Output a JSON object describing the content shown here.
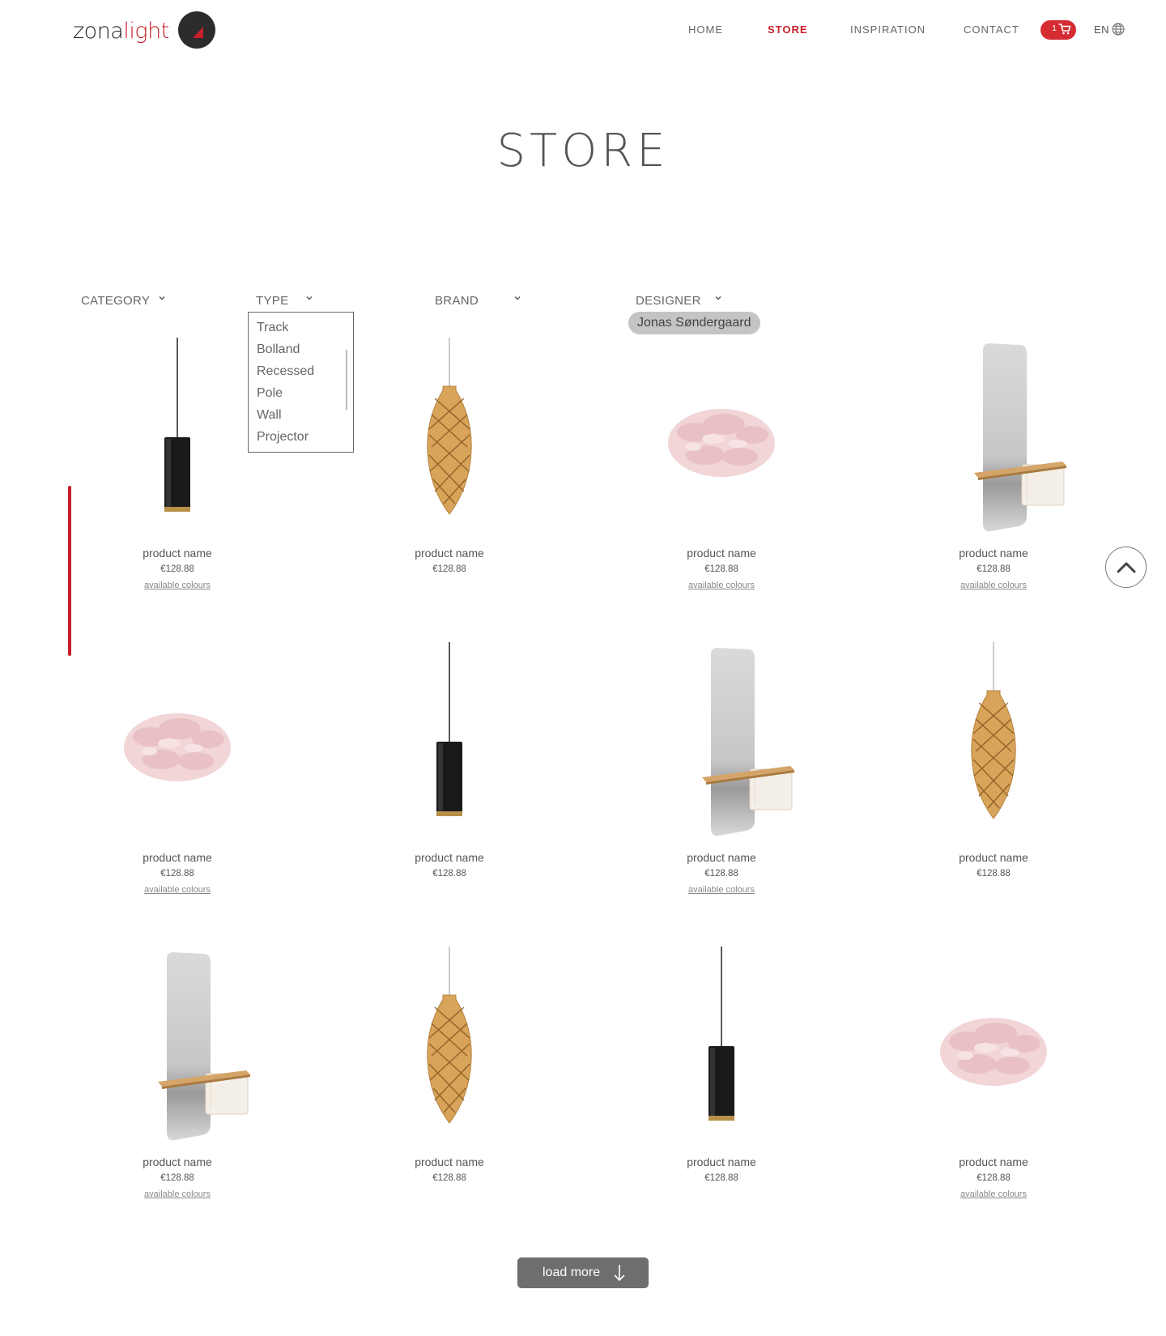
{
  "header": {
    "logo_text_dark": "zona",
    "logo_text_accent": "light",
    "nav": [
      "HOME",
      "STORE",
      "INSPIRATION",
      "CONTACT"
    ],
    "active_nav": "STORE",
    "cart_count": "1",
    "language": "EN",
    "icons": {
      "cart": "cart-icon",
      "globe": "globe-icon"
    }
  },
  "page_title": "STORE",
  "filters": {
    "category": "CATEGORY",
    "type": "TYPE",
    "brand": "BRAND",
    "designer": "DESIGNER",
    "type_options": [
      "Track",
      "Bolland",
      "Recessed",
      "Pole",
      "Wall",
      "Projector"
    ],
    "designer_selected": "Jonas Søndergaard"
  },
  "products": [
    {
      "image": "pendant-cylinder-black",
      "name": "product name",
      "price": "€128.88",
      "colours": "available colours"
    },
    {
      "image": "pendant-lattice-wood",
      "name": "product name",
      "price": "€128.88"
    },
    {
      "image": "feather-shade-pink",
      "name": "product name",
      "price": "€128.88",
      "colours": "available colours"
    },
    {
      "image": "mirror-shelf",
      "name": "product name",
      "price": "€128.88",
      "colours": "available colours"
    },
    {
      "image": "feather-shade-pink",
      "name": "product name",
      "price": "€128.88",
      "colours": "available colours"
    },
    {
      "image": "pendant-cylinder-black",
      "name": "product name",
      "price": "€128.88"
    },
    {
      "image": "mirror-shelf",
      "name": "product name",
      "price": "€128.88",
      "colours": "available colours"
    },
    {
      "image": "pendant-lattice-wood",
      "name": "product name",
      "price": "€128.88"
    },
    {
      "image": "mirror-shelf",
      "name": "product name",
      "price": "€128.88",
      "colours": "available colours"
    },
    {
      "image": "pendant-lattice-wood",
      "name": "product name",
      "price": "€128.88"
    },
    {
      "image": "pendant-cylinder-black",
      "name": "product name",
      "price": "€128.88"
    },
    {
      "image": "feather-shade-pink",
      "name": "product name",
      "price": "€128.88",
      "colours": "available colours"
    }
  ],
  "back_to_top_icon": "chevron-up-icon",
  "load_more": "load more",
  "load_more_icon": "arrow-down-icon",
  "colors": {
    "accent": "#c8202a",
    "text": "#555555",
    "button": "#6e6e6e",
    "chip": "#c4c4c4"
  }
}
